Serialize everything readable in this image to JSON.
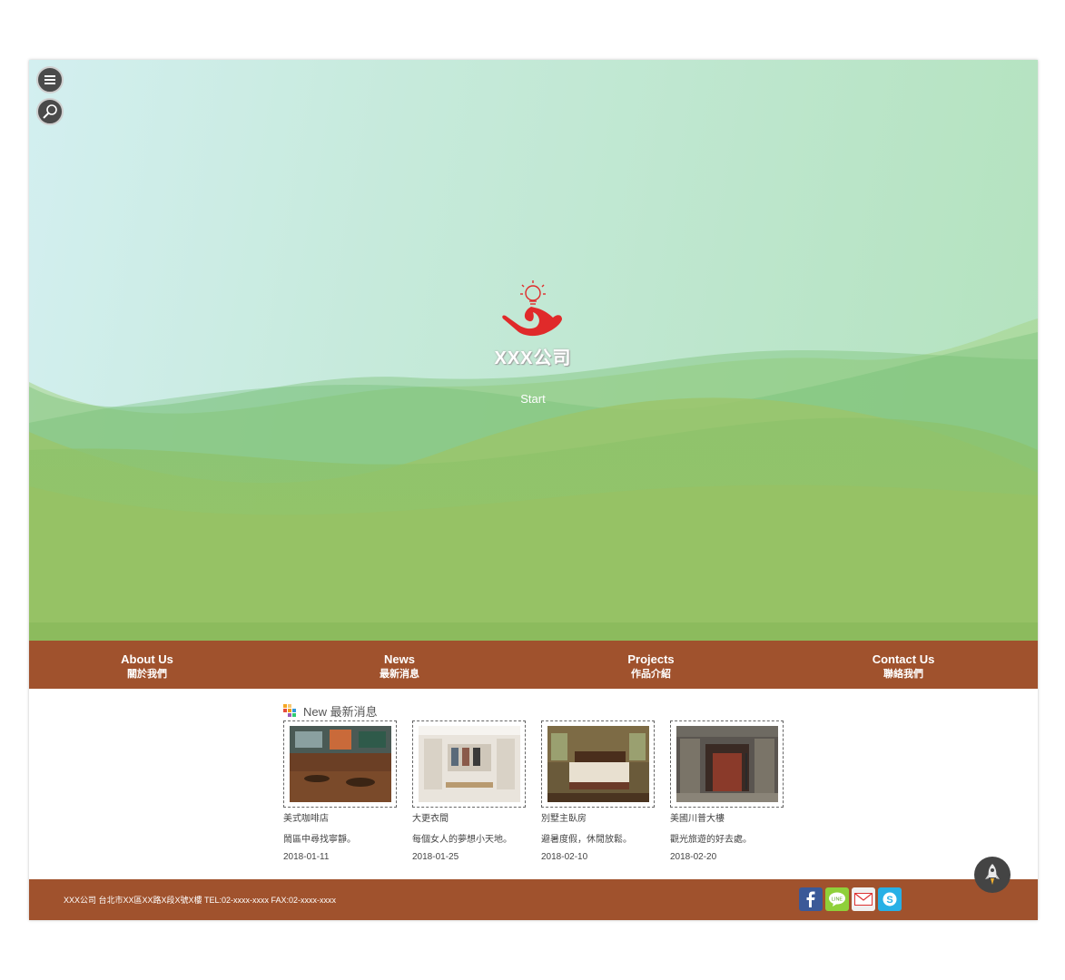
{
  "hero": {
    "company_name": "XXX公司",
    "start_label": "Start"
  },
  "icons": {
    "menu": "menu-icon",
    "search": "search-icon",
    "logo": "lightbulb-hand-logo",
    "back_to_top": "rocket-icon"
  },
  "nav": [
    {
      "en": "About Us",
      "zh": "關於我們"
    },
    {
      "en": "News",
      "zh": "最新消息"
    },
    {
      "en": "Projects",
      "zh": "作品介紹"
    },
    {
      "en": "Contact Us",
      "zh": "聯絡我們"
    }
  ],
  "news": {
    "title": "New 最新消息",
    "items": [
      {
        "name": "美式咖啡店",
        "desc": "鬧區中尋找寧靜。",
        "date": "2018-01-11"
      },
      {
        "name": "大更衣間",
        "desc": "每個女人的夢想小天地。",
        "date": "2018-01-25"
      },
      {
        "name": "別墅主臥房",
        "desc": "避暑度假，休閒放鬆。",
        "date": "2018-02-10"
      },
      {
        "name": "美國川普大樓",
        "desc": "觀光旅遊的好去處。",
        "date": "2018-02-20"
      }
    ]
  },
  "footer": {
    "address": "XXX公司 台北市XX區XX路X段X號X樓   TEL:02-xxxx-xxxx   FAX:02-xxxx-xxxx",
    "social": [
      "facebook-icon",
      "line-icon",
      "email-icon",
      "skype-icon"
    ]
  },
  "colors": {
    "nav_bg": "#a0522d",
    "footer_bg": "#a0522d",
    "hero_green": "#9bc46a",
    "logo_red": "#e02a2a"
  }
}
